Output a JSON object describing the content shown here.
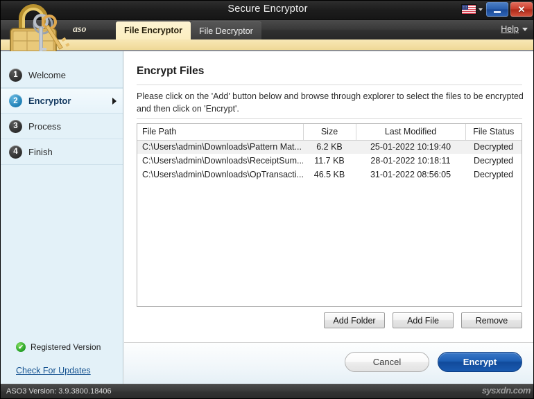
{
  "window": {
    "title": "Secure Encryptor",
    "minimize_label": "—",
    "close_label": "✕",
    "language_flag": "us-flag-icon"
  },
  "tabbar": {
    "brand": "aso",
    "tabs": [
      {
        "label": "File Encryptor",
        "active": true
      },
      {
        "label": "File Decryptor",
        "active": false
      }
    ],
    "help": {
      "label": "Help",
      "accel": "H"
    }
  },
  "sidebar": {
    "items": [
      {
        "num": "1",
        "label": "Welcome",
        "active": false
      },
      {
        "num": "2",
        "label": "Encryptor",
        "active": true
      },
      {
        "num": "3",
        "label": "Process",
        "active": false
      },
      {
        "num": "4",
        "label": "Finish",
        "active": false
      }
    ],
    "registered_label": "Registered Version",
    "registered_mark": "✔",
    "updates_link": "Check For Updates"
  },
  "main": {
    "title": "Encrypt Files",
    "instructions": "Please click on the 'Add' button below and browse through explorer to select the files to be encrypted and then click on 'Encrypt'.",
    "table": {
      "columns": [
        "File Path",
        "Size",
        "Last Modified",
        "File Status"
      ],
      "rows": [
        {
          "path": "C:\\Users\\admin\\Downloads\\Pattern Mat...",
          "size": "6.2 KB",
          "modified": "25-01-2022 10:19:40",
          "status": "Decrypted"
        },
        {
          "path": "C:\\Users\\admin\\Downloads\\ReceiptSum...",
          "size": "11.7 KB",
          "modified": "28-01-2022 10:18:11",
          "status": "Decrypted"
        },
        {
          "path": "C:\\Users\\admin\\Downloads\\OpTransacti...",
          "size": "46.5 KB",
          "modified": "31-01-2022 08:56:05",
          "status": "Decrypted"
        }
      ]
    },
    "buttons": {
      "add_folder": "Add Folder",
      "add_file": "Add File",
      "remove": "Remove"
    },
    "actions": {
      "cancel": "Cancel",
      "encrypt": "Encrypt"
    }
  },
  "statusbar": {
    "version": "ASO3 Version: 3.9.3800.18406",
    "watermark": "sysxdn.com"
  },
  "colors": {
    "accent_blue": "#1d5fb4",
    "tab_active_bg": "#fbeec0",
    "sidebar_bg": "#e3f1f8",
    "link": "#12508f",
    "close_red": "#c93d2c"
  }
}
